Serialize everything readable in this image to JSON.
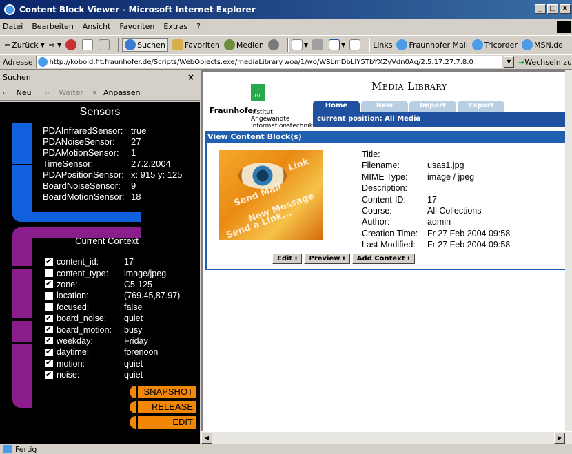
{
  "window": {
    "title": "Content Block Viewer - Microsoft Internet Explorer",
    "buttons": [
      "_",
      "□",
      "X"
    ]
  },
  "menu": [
    "Datei",
    "Bearbeiten",
    "Ansicht",
    "Favoriten",
    "Extras",
    "?"
  ],
  "toolbar": {
    "back": "Zurück",
    "search": "Suchen",
    "favorites": "Favoriten",
    "media": "Medien",
    "links_label": "Links",
    "link1": "Fraunhofer Mail",
    "link2": "Tricorder",
    "link3": "MSN.de"
  },
  "address": {
    "label": "Adresse",
    "url": "http://kobold.fit.fraunhofer.de/Scripts/WebObjects.exe/mediaLibrary.woa/1/wo/WSLmDbLIY5TbYXZyVdn0Ag/2.5.17.27.7.8.0",
    "go": "Wechseln zu"
  },
  "search_pane": {
    "title": "Suchen",
    "close": "×",
    "new": "Neu",
    "next": "Weiter",
    "customize": "Anpassen"
  },
  "sensors": {
    "title": "Sensors",
    "items": [
      {
        "name": "PDAInfraredSensor:",
        "value": "true"
      },
      {
        "name": "PDANoiseSensor:",
        "value": "27"
      },
      {
        "name": "PDAMotionSensor:",
        "value": "1"
      },
      {
        "name": "TimeSensor:",
        "value": "27.2.2004"
      },
      {
        "name": "PDAPositionSensor:",
        "value": "x: 915 y: 125"
      },
      {
        "name": "BoardNoiseSensor:",
        "value": "9"
      },
      {
        "name": "BoardMotionSensor:",
        "value": "18"
      }
    ]
  },
  "context": {
    "title": "Current Context",
    "items": [
      {
        "name": "content_id:",
        "value": "17",
        "checked": true
      },
      {
        "name": "content_type:",
        "value": "image/jpeg",
        "checked": false
      },
      {
        "name": "zone:",
        "value": "C5-125",
        "checked": true
      },
      {
        "name": "location:",
        "value": "(769.45,87.97)",
        "checked": false
      },
      {
        "name": "focused:",
        "value": "false",
        "checked": false
      },
      {
        "name": "board_noise:",
        "value": "quiet",
        "checked": true
      },
      {
        "name": "board_motion:",
        "value": "busy",
        "checked": true
      },
      {
        "name": "weekday:",
        "value": "Friday",
        "checked": true
      },
      {
        "name": "daytime:",
        "value": "forenoon",
        "checked": true
      },
      {
        "name": "motion:",
        "value": "quiet",
        "checked": true
      },
      {
        "name": "noise:",
        "value": "quiet",
        "checked": true
      }
    ],
    "buttons": {
      "snapshot": "SNAPSHOT",
      "release": "RELEASE",
      "edit": "EDIT"
    }
  },
  "media_library": {
    "title": "Media Library",
    "logo_text": "FIT",
    "org": "Fraunhofer",
    "institute": [
      "Institut",
      "Angewandte",
      "Informationstechnik"
    ],
    "tabs": [
      "Home",
      "New",
      "Import",
      "Export"
    ],
    "position": "current position: All Media",
    "section_title": "View Content Block(s)",
    "thumb_text": [
      "Send a Link...",
      "New Message",
      "Send Mail",
      "Link"
    ],
    "fields": [
      {
        "k": "Title:",
        "v": ""
      },
      {
        "k": "Filename:",
        "v": "usas1.jpg"
      },
      {
        "k": "MIME Type:",
        "v": "image / jpeg"
      },
      {
        "k": "Description:",
        "v": ""
      },
      {
        "k": "Content-ID:",
        "v": "17"
      },
      {
        "k": "Course:",
        "v": "All Collections"
      },
      {
        "k": "Author:",
        "v": "admin"
      },
      {
        "k": "Creation Time:",
        "v": "Fr 27 Feb 2004 09:58"
      },
      {
        "k": "Last Modified:",
        "v": "Fr 27 Feb 2004 09:58"
      }
    ],
    "actions": {
      "edit": "Edit",
      "preview": "Preview",
      "add_context": "Add Context"
    }
  },
  "status": {
    "text": "Fertig"
  },
  "colors": {
    "sensor_blue": "#1160dd",
    "context_purple": "#8b1c8c",
    "button_orange": "#f28705",
    "ml_blue": "#2060b0"
  }
}
